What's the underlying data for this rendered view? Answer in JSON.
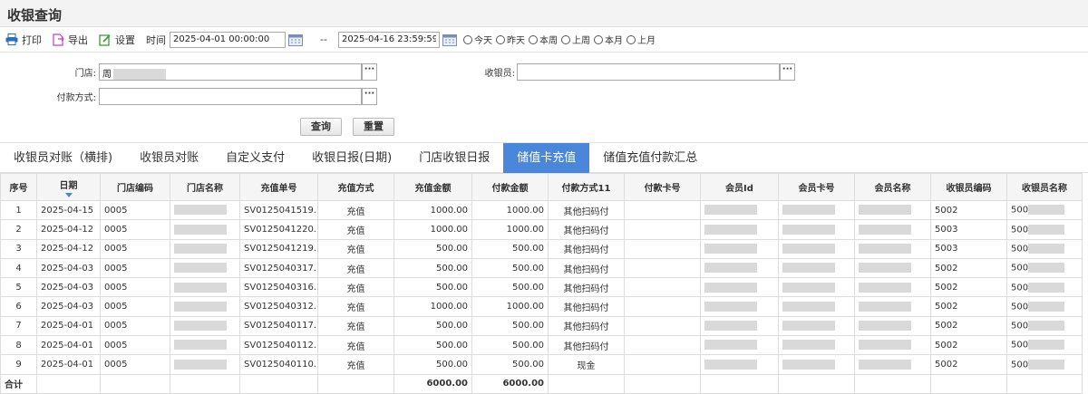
{
  "title": "收银查询",
  "toolbar": {
    "print": "打印",
    "export": "导出",
    "settings": "设置",
    "time_label": "时间",
    "date_from": "2025-04-01 00:00:00",
    "date_to": "2025-04-16 23:59:59",
    "dash": "--",
    "radios": [
      "今天",
      "昨天",
      "本周",
      "上周",
      "本月",
      "上月"
    ]
  },
  "filters": {
    "store_label": "门店:",
    "store_value": "周",
    "cashier_label": "收银员:",
    "cashier_value": "",
    "payment_label": "付款方式:",
    "payment_value": "",
    "dots": "···",
    "query": "查询",
    "reset": "重置"
  },
  "tabs": [
    "收银员对账（横排)",
    "收银员对账",
    "自定义支付",
    "收银日报(日期)",
    "门店收银日报",
    "储值卡充值",
    "储值充值付款汇总"
  ],
  "active_tab": 5,
  "columns": [
    "序号",
    "日期",
    "门店编码",
    "门店名称",
    "充值单号",
    "充值方式",
    "充值金额",
    "付款金额",
    "付款方式11",
    "付款卡号",
    "会员Id",
    "会员卡号",
    "会员名称",
    "收银员编码",
    "收银员名称"
  ],
  "rows": [
    {
      "no": "1",
      "date": "2025-04-15",
      "store": "0005",
      "order": "SV0125041519...",
      "method": "充值",
      "amount": "1000.00",
      "paid": "1000.00",
      "pay": "其他扫码付",
      "cashier": "5002",
      "cname": "500"
    },
    {
      "no": "2",
      "date": "2025-04-12",
      "store": "0005",
      "order": "SV0125041220...",
      "method": "充值",
      "amount": "1000.00",
      "paid": "1000.00",
      "pay": "其他扫码付",
      "cashier": "5003",
      "cname": "500"
    },
    {
      "no": "3",
      "date": "2025-04-12",
      "store": "0005",
      "order": "SV0125041219...",
      "method": "充值",
      "amount": "500.00",
      "paid": "500.00",
      "pay": "其他扫码付",
      "cashier": "5003",
      "cname": "500"
    },
    {
      "no": "4",
      "date": "2025-04-03",
      "store": "0005",
      "order": "SV0125040317...",
      "method": "充值",
      "amount": "500.00",
      "paid": "500.00",
      "pay": "其他扫码付",
      "cashier": "5002",
      "cname": "500"
    },
    {
      "no": "5",
      "date": "2025-04-03",
      "store": "0005",
      "order": "SV0125040316...",
      "method": "充值",
      "amount": "500.00",
      "paid": "500.00",
      "pay": "其他扫码付",
      "cashier": "5002",
      "cname": "500"
    },
    {
      "no": "6",
      "date": "2025-04-03",
      "store": "0005",
      "order": "SV0125040312...",
      "method": "充值",
      "amount": "1000.00",
      "paid": "1000.00",
      "pay": "其他扫码付",
      "cashier": "5002",
      "cname": "500"
    },
    {
      "no": "7",
      "date": "2025-04-01",
      "store": "0005",
      "order": "SV0125040117...",
      "method": "充值",
      "amount": "500.00",
      "paid": "500.00",
      "pay": "其他扫码付",
      "cashier": "5002",
      "cname": "500"
    },
    {
      "no": "8",
      "date": "2025-04-01",
      "store": "0005",
      "order": "SV0125040112...",
      "method": "充值",
      "amount": "500.00",
      "paid": "500.00",
      "pay": "其他扫码付",
      "cashier": "5002",
      "cname": "500"
    },
    {
      "no": "9",
      "date": "2025-04-01",
      "store": "0005",
      "order": "SV0125040110...",
      "method": "充值",
      "amount": "500.00",
      "paid": "500.00",
      "pay": "现金",
      "cashier": "5002",
      "cname": "500"
    }
  ],
  "footer": {
    "label": "合计",
    "amount": "6000.00",
    "paid": "6000.00"
  },
  "colors": {
    "accent": "#4a86d9",
    "redact": "#d9d9d9"
  }
}
